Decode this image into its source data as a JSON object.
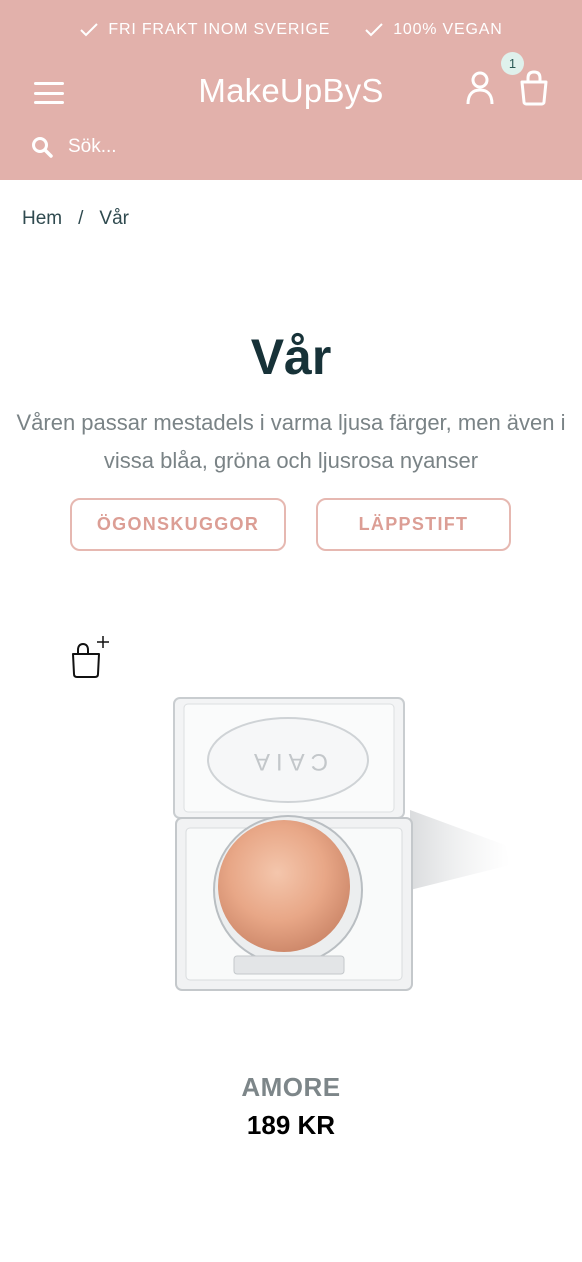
{
  "header": {
    "usps": [
      {
        "label": "FRI FRAKT INOM SVERIGE",
        "icon": "check-icon"
      },
      {
        "label": "100% VEGAN",
        "icon": "check-icon"
      }
    ],
    "logo_text": "MakeUpByS",
    "cart_count": "1",
    "search_placeholder": "Sök...",
    "background_color": "#e2b1ab"
  },
  "breadcrumb": {
    "items": [
      "Hem",
      "Vår"
    ],
    "separator": "/"
  },
  "collection": {
    "title": "Vår",
    "description": "Våren passar mestadels i varma ljusa färger, men även i vissa blåa, gröna och ljusrosa nyanser",
    "buttons": [
      "ÖGONSKUGGOR",
      "LÄPPSTIFT"
    ]
  },
  "product": {
    "name": "AMORE",
    "price": "189 KR",
    "image_brand_text": "CAIA"
  },
  "colors": {
    "accent": "#dc9e95",
    "title": "#173238",
    "badge": "#dff1ec"
  }
}
